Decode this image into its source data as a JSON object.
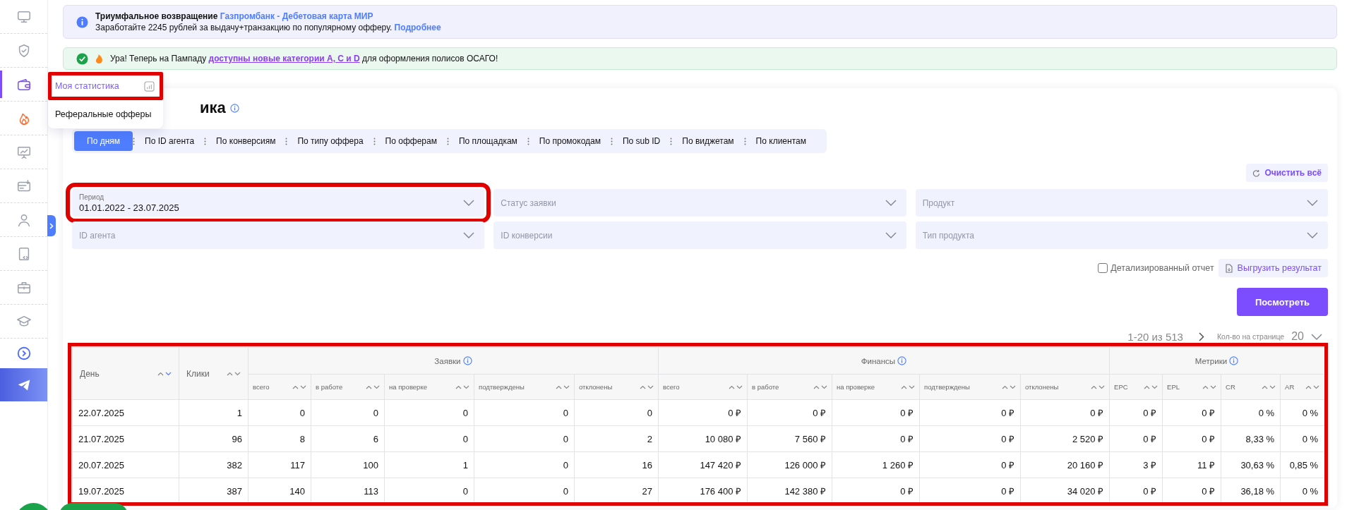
{
  "sidebar": {
    "items": [
      {
        "selected": false
      },
      {
        "selected": false
      },
      {
        "selected": true
      },
      {
        "selected": false
      },
      {
        "selected": false
      },
      {
        "selected": false
      },
      {
        "selected": false
      },
      {
        "selected": false
      },
      {
        "selected": false
      },
      {
        "selected": false
      }
    ]
  },
  "banners": [
    {
      "kind": "info",
      "title": "Триумфальное возвращение",
      "title_link": "Газпромбанк - Дебетовая карта МИР",
      "text": "Заработайте 2245 рублей за выдачу+транзакцию по популярному офферу.",
      "text_link": "Подробнее"
    },
    {
      "kind": "success",
      "text_before": "Ура! Теперь на Пампаду",
      "link": "доступны новые категории А, С и D",
      "text_after": "для оформления полисов ОСАГО!"
    }
  ],
  "menu": {
    "items": [
      {
        "label": "Моя статистика",
        "selected": true,
        "highlighted": true
      },
      {
        "label": "Реферальные офферы",
        "selected": false,
        "highlighted": false
      }
    ]
  },
  "page_title": "ика",
  "tabs": [
    {
      "label": "По дням",
      "selected": true
    },
    {
      "label": "По ID агента",
      "selected": false
    },
    {
      "label": "По конверсиям",
      "selected": false
    },
    {
      "label": "По типу оффера",
      "selected": false
    },
    {
      "label": "По офферам",
      "selected": false
    },
    {
      "label": "По площадкам",
      "selected": false
    },
    {
      "label": "По промокодам",
      "selected": false
    },
    {
      "label": "По sub ID",
      "selected": false
    },
    {
      "label": "По виджетам",
      "selected": false
    },
    {
      "label": "По клиентам",
      "selected": false
    }
  ],
  "clear_button": "Очистить всё",
  "filters": [
    {
      "label": "Период",
      "value": "01.01.2022 - 23.07.2025",
      "highlighted": true
    },
    {
      "placeholder": "Статус заявки",
      "highlighted": false
    },
    {
      "placeholder": "Продукт",
      "highlighted": false
    },
    {
      "placeholder": "ID агента",
      "highlighted": false
    },
    {
      "placeholder": "ID конверсии",
      "highlighted": false
    },
    {
      "placeholder": "Тип продукта",
      "highlighted": false
    }
  ],
  "detailed_report": {
    "label": "Детализированный отчет",
    "checked": false
  },
  "export_button": "Выгрузить результат",
  "submit_button": "Посмотреть",
  "pagination": {
    "range": "1-20 из 513",
    "per_page_label": "Кол-во на странице",
    "per_page": "20"
  },
  "table": {
    "highlighted": true,
    "columns": [
      {
        "label": "День",
        "sorted": true
      },
      {
        "label": "Клики",
        "sorted": false
      }
    ],
    "groups": [
      {
        "label": "Заявки",
        "columns": [
          {
            "label": "всего",
            "sorted": false
          },
          {
            "label": "в работе",
            "sorted": false
          },
          {
            "label": "на проверке",
            "sorted": false
          },
          {
            "label": "подтверждены",
            "sorted": false
          },
          {
            "label": "отклонены",
            "sorted": false
          }
        ]
      },
      {
        "label": "Финансы",
        "columns": [
          {
            "label": "всего",
            "sorted": false
          },
          {
            "label": "в работе",
            "sorted": false
          },
          {
            "label": "на проверке",
            "sorted": false
          },
          {
            "label": "подтверждены",
            "sorted": false
          },
          {
            "label": "отклонены",
            "sorted": false
          }
        ]
      },
      {
        "label": "Метрики",
        "columns": [
          {
            "label": "EPC",
            "sorted": false
          },
          {
            "label": "EPL",
            "sorted": false
          },
          {
            "label": "CR",
            "sorted": false
          },
          {
            "label": "AR",
            "sorted": false
          }
        ]
      }
    ],
    "rows": [
      {
        "cells": [
          "22.07.2025",
          "1",
          "0",
          "0",
          "0",
          "0",
          "0",
          "0 ₽",
          "0 ₽",
          "0 ₽",
          "0 ₽",
          "0 ₽",
          "0 ₽",
          "0 ₽",
          "0 %",
          "0 %"
        ]
      },
      {
        "cells": [
          "21.07.2025",
          "96",
          "8",
          "6",
          "0",
          "0",
          "2",
          "10 080 ₽",
          "7 560 ₽",
          "0 ₽",
          "0 ₽",
          "2 520 ₽",
          "0 ₽",
          "0 ₽",
          "8,33 %",
          "0 %"
        ]
      },
      {
        "cells": [
          "20.07.2025",
          "382",
          "117",
          "100",
          "1",
          "0",
          "16",
          "147 420 ₽",
          "126 000 ₽",
          "1 260 ₽",
          "0 ₽",
          "20 160 ₽",
          "3 ₽",
          "11 ₽",
          "30,63 %",
          "0,85 %"
        ]
      },
      {
        "cells": [
          "19.07.2025",
          "387",
          "140",
          "113",
          "0",
          "0",
          "27",
          "176 400 ₽",
          "142 380 ₽",
          "0 ₽",
          "0 ₽",
          "34 020 ₽",
          "0 ₽",
          "0 ₽",
          "36,18 %",
          "0 %"
        ]
      }
    ]
  }
}
